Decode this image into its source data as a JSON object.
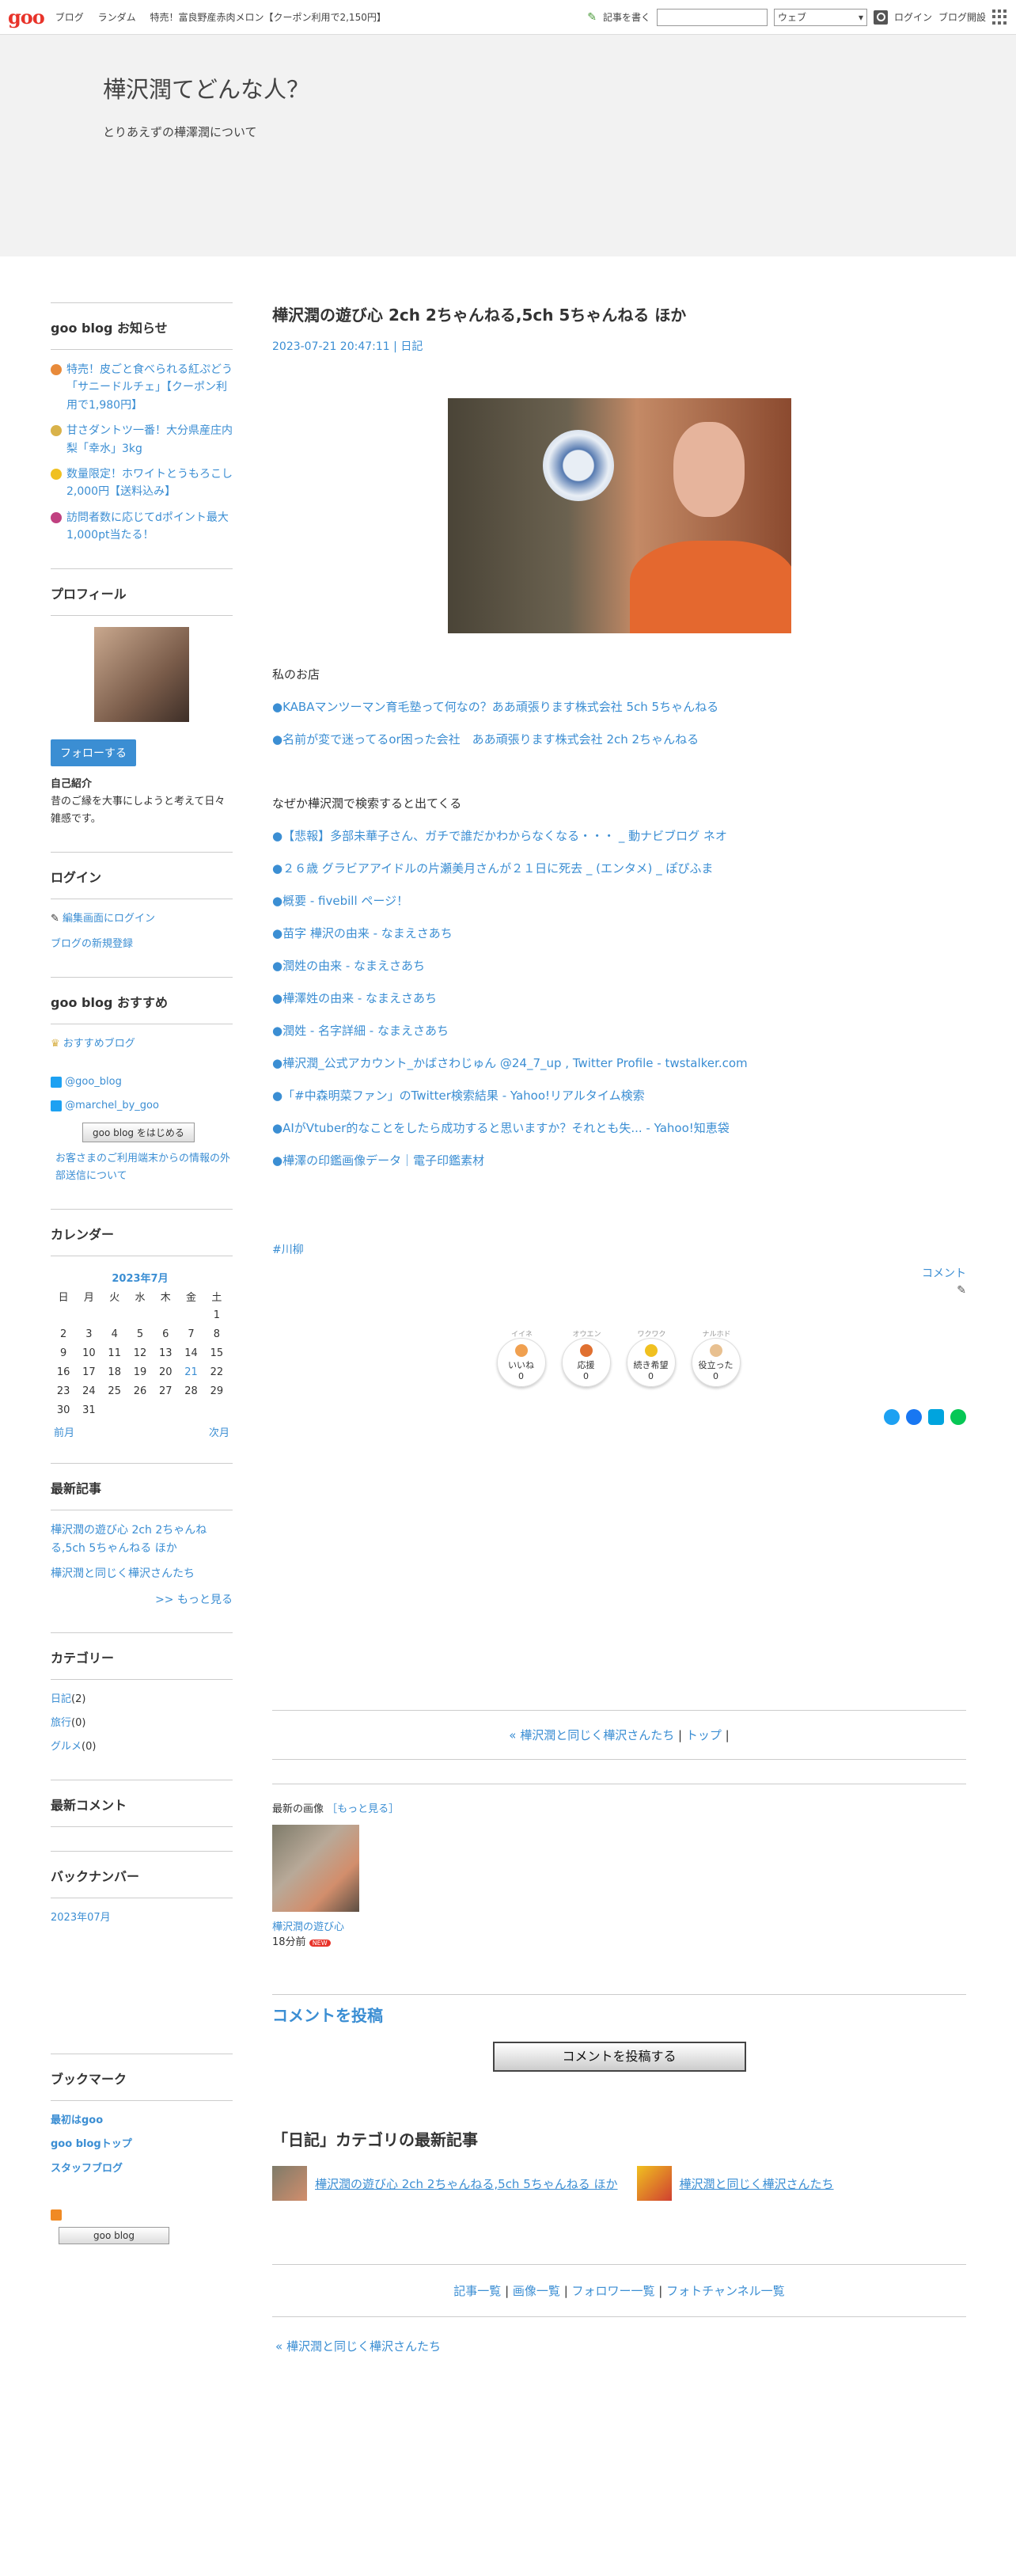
{
  "topbar": {
    "logo": "goo",
    "nav": [
      "ブログ",
      "ランダム",
      "特売！富良野産赤肉メロン【クーポン利用で2,150円】"
    ],
    "write": "記事を書く",
    "search_select": "ウェブ",
    "login": "ログイン",
    "open": "ブログ開設"
  },
  "hero": {
    "title": "樺沢潤てどんな人？",
    "subtitle": "とりあえずの樺澤潤について"
  },
  "side": {
    "notice": {
      "title": "goo blog お知らせ",
      "items": [
        "特売！皮ごと食べられる紅ぷどう「サニードルチェ」【クーポン利用で1,980円】",
        "甘さダントツ一番！大分県産庄内梨「幸水」3kg",
        "数量限定！ホワイトとうもろこし2,000円【送料込み】",
        "訪問者数に応じてdポイント最大1,000pt当たる！"
      ]
    },
    "profile": {
      "title": "プロフィール",
      "follow": "フォローする",
      "intro_label": "自己紹介",
      "intro": "昔のご縁を大事にしようと考えて日々雑感です。"
    },
    "login": {
      "title": "ログイン",
      "edit": "編集画面にログイン",
      "new": "ブログの新規登録"
    },
    "recommend": {
      "title": "goo blog おすすめ",
      "rec": "おすすめブログ",
      "tw1": "@goo_blog",
      "tw2": "@marchel_by_goo",
      "start": "goo blog をはじめる",
      "ext": "お客さまのご利用端末からの情報の外部送信について"
    },
    "calendar": {
      "title": "カレンダー",
      "month": "2023年7月",
      "days": [
        "日",
        "月",
        "火",
        "水",
        "木",
        "金",
        "土"
      ],
      "weeks": [
        [
          "",
          "",
          "",
          "",
          "",
          "",
          "1"
        ],
        [
          "2",
          "3",
          "4",
          "5",
          "6",
          "7",
          "8"
        ],
        [
          "9",
          "10",
          "11",
          "12",
          "13",
          "14",
          "15"
        ],
        [
          "16",
          "17",
          "18",
          "19",
          "20",
          "21",
          "22"
        ],
        [
          "23",
          "24",
          "25",
          "26",
          "27",
          "28",
          "29"
        ],
        [
          "30",
          "31",
          "",
          "",
          "",
          "",
          ""
        ]
      ],
      "prev": "前月",
      "next": "次月"
    },
    "latest": {
      "title": "最新記事",
      "items": [
        "樺沢潤の遊び心 2ch 2ちゃんねる,5ch 5ちゃんねる ほか",
        "樺沢潤と同じく樺沢さんたち"
      ],
      "more": ">> もっと見る"
    },
    "category": {
      "title": "カテゴリー",
      "items": [
        {
          "name": "日記",
          "count": "(2)"
        },
        {
          "name": "旅行",
          "count": "(0)"
        },
        {
          "name": "グルメ",
          "count": "(0)"
        }
      ]
    },
    "comments": {
      "title": "最新コメント"
    },
    "backnum": {
      "title": "バックナンバー",
      "item": "2023年07月"
    },
    "bookmark": {
      "title": "ブックマーク",
      "items": [
        "最初はgoo",
        "goo blogトップ",
        "スタッフブログ"
      ],
      "badge": "goo blog"
    }
  },
  "post": {
    "title": "樺沢潤の遊び心 2ch 2ちゃんねる,5ch 5ちゃんねる ほか",
    "date": "2023-07-21 20:47:11",
    "sep": " | ",
    "category": "日記",
    "intro1": "私のお店",
    "links1": [
      "●KABAマンツーマン育毛塾って何なの？ああ頑張ります株式会社 5ch 5ちゃんねる",
      "●名前が変で迷ってるor困った会社　ああ頑張ります株式会社 2ch 2ちゃんねる"
    ],
    "intro2": "なぜか樺沢潤で検索すると出てくる",
    "links2": [
      "●【悲報】多部未華子さん、ガチで誰だかわからなくなる・・・ _ 動ナビブログ ネオ",
      "●２６歳 グラビアアイドルの片瀬美月さんが２１日に死去 _ (エンタメ) _ ぽぴふま",
      "●概要 - fivebill ページ！",
      "●苗字 樺沢の由来 - なまえさあち",
      "●潤姓の由来 - なまえさあち",
      "●樺澤姓の由来 - なまえさあち",
      "●潤姓 - 名字詳細 - なまえさあち",
      "●樺沢潤_公式アカウント_かばさわじゅん @24_7_up , Twitter Profile - twstalker.com",
      "●「#中森明菜ファン」のTwitter検索結果 - Yahoo!リアルタイム検索",
      "●AIがVtuber的なことをしたら成功すると思いますか？それとも失... - Yahoo!知恵袋",
      "●樺澤の印鑑画像データ｜電子印鑑素材"
    ],
    "tag": "#川柳",
    "comment": "コメント",
    "reactions": [
      {
        "top": "イイネ",
        "label": "いいね",
        "count": "0"
      },
      {
        "top": "オウエン",
        "label": "応援",
        "count": "0"
      },
      {
        "top": "ワクワク",
        "label": "続き希望",
        "count": "0"
      },
      {
        "top": "ナルホド",
        "label": "役立った",
        "count": "0"
      }
    ],
    "pager_prev": "« 樺沢潤と同じく樺沢さんたち",
    "pager_top": "トップ",
    "recent_label": "最新の画像",
    "recent_more": "［もっと見る］",
    "recent_caption": "樺沢潤の遊び心",
    "recent_time": "18分前",
    "new": "NEW",
    "cmt_title": "コメントを投稿",
    "cmt_btn": "コメントを投稿する",
    "cat_title": "「日記」カテゴリの最新記事",
    "cat_items": [
      "樺沢潤の遊び心 2ch 2ちゃんねる,5ch 5ちゃんねる ほか",
      "樺沢潤と同じく樺沢さんたち"
    ],
    "footer": [
      "記事一覧",
      "画像一覧",
      "フォロワー一覧",
      "フォトチャンネル一覧"
    ],
    "back": "« 樺沢潤と同じく樺沢さんたち"
  }
}
